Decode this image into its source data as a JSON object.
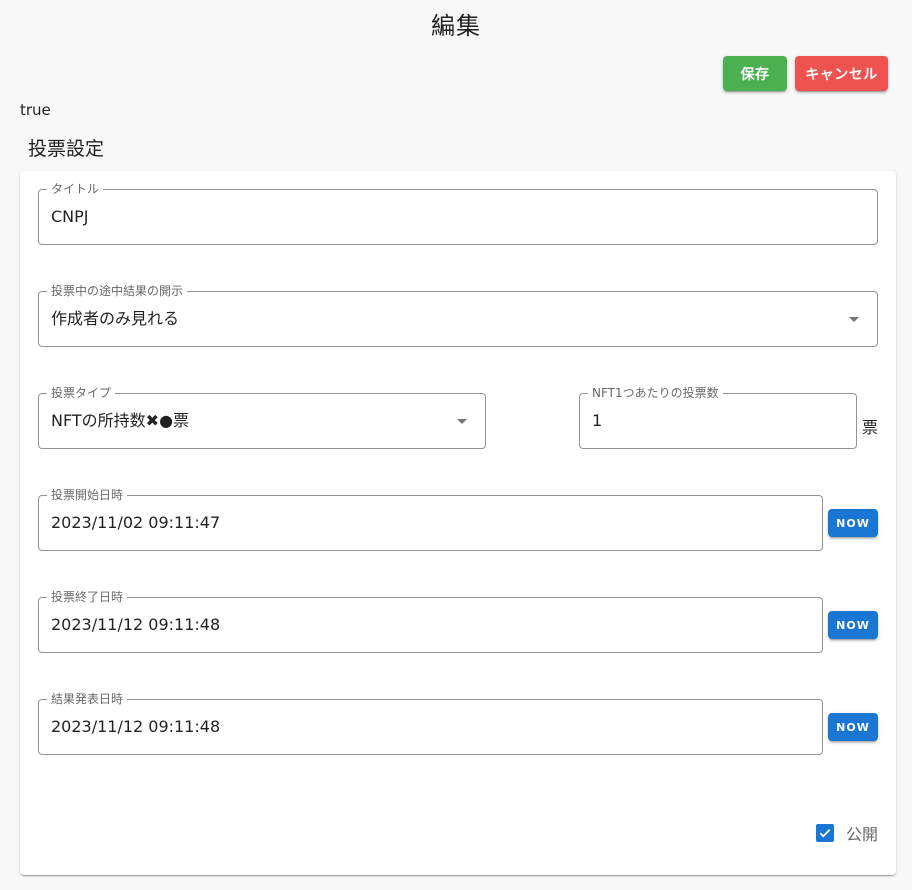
{
  "page": {
    "title": "編集",
    "debug_text": "true",
    "section_title": "投票設定"
  },
  "actions": {
    "save_label": "保存",
    "cancel_label": "キャンセル"
  },
  "colors": {
    "save": "#4caf50",
    "cancel": "#ef5350",
    "primary": "#1976d2"
  },
  "form": {
    "title_field": {
      "label": "タイトル",
      "value": "CNPJ"
    },
    "interim_result_field": {
      "label": "投票中の途中結果の開示",
      "value": "作成者のみ見れる",
      "icon": "arrow-drop-down-icon"
    },
    "vote_type_field": {
      "label": "投票タイプ",
      "value": "NFTの所持数✖●票",
      "icon": "arrow-drop-down-icon"
    },
    "votes_per_nft_field": {
      "label": "NFT1つあたりの投票数",
      "value": "1",
      "unit": "票"
    },
    "start_datetime_field": {
      "label": "投票開始日時",
      "value": "2023/11/02 09:11:47",
      "now_label": "NOW"
    },
    "end_datetime_field": {
      "label": "投票終了日時",
      "value": "2023/11/12 09:11:48",
      "now_label": "NOW"
    },
    "result_datetime_field": {
      "label": "結果発表日時",
      "value": "2023/11/12 09:11:48",
      "now_label": "NOW"
    },
    "public_checkbox": {
      "label": "公開",
      "checked": true,
      "icon": "check-icon"
    }
  }
}
